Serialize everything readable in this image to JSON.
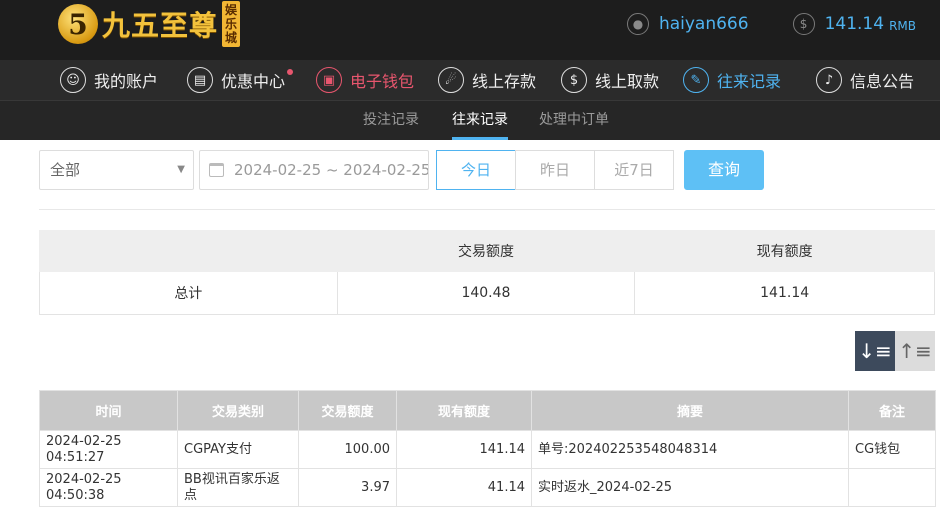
{
  "header": {
    "logo_mark": "5",
    "logo_text": "九五至尊",
    "logo_badge": "娱乐城",
    "username": "haiyan666",
    "balance": "141.14",
    "currency": "RMB"
  },
  "nav": {
    "items": [
      {
        "label": "我的账户",
        "icon": "user-icon"
      },
      {
        "label": "优惠中心",
        "icon": "gift-icon"
      },
      {
        "label": "电子钱包",
        "icon": "wallet-icon"
      },
      {
        "label": "线上存款",
        "icon": "deposit-icon"
      },
      {
        "label": "线上取款",
        "icon": "withdraw-icon"
      },
      {
        "label": "往来记录",
        "icon": "records-icon"
      },
      {
        "label": "信息公告",
        "icon": "bell-icon"
      }
    ]
  },
  "subnav": {
    "items": [
      "投注记录",
      "往来记录",
      "处理中订单"
    ]
  },
  "filters": {
    "type_select": "全部",
    "date_range": "2024-02-25 ~ 2024-02-25",
    "quick": [
      "今日",
      "昨日",
      "近7日"
    ],
    "query": "查询"
  },
  "summary": {
    "headers": [
      "",
      "交易额度",
      "现有额度"
    ],
    "row": [
      "总计",
      "140.48",
      "141.14"
    ]
  },
  "detail": {
    "headers": [
      "时间",
      "交易类别",
      "交易额度",
      "现有额度",
      "摘要",
      "备注"
    ],
    "rows": [
      [
        "2024-02-25 04:51:27",
        "CGPAY支付",
        "100.00",
        "141.14",
        "单号:202402253548048314",
        "CG钱包"
      ],
      [
        "2024-02-25 04:50:38",
        "BB视讯百家乐返点",
        "3.97",
        "41.14",
        "实时返水_2024-02-25",
        ""
      ]
    ]
  },
  "colors": {
    "accent_blue": "#4fb3f0",
    "accent_red": "#e8566e",
    "header_bg": "#1d1d1d"
  }
}
